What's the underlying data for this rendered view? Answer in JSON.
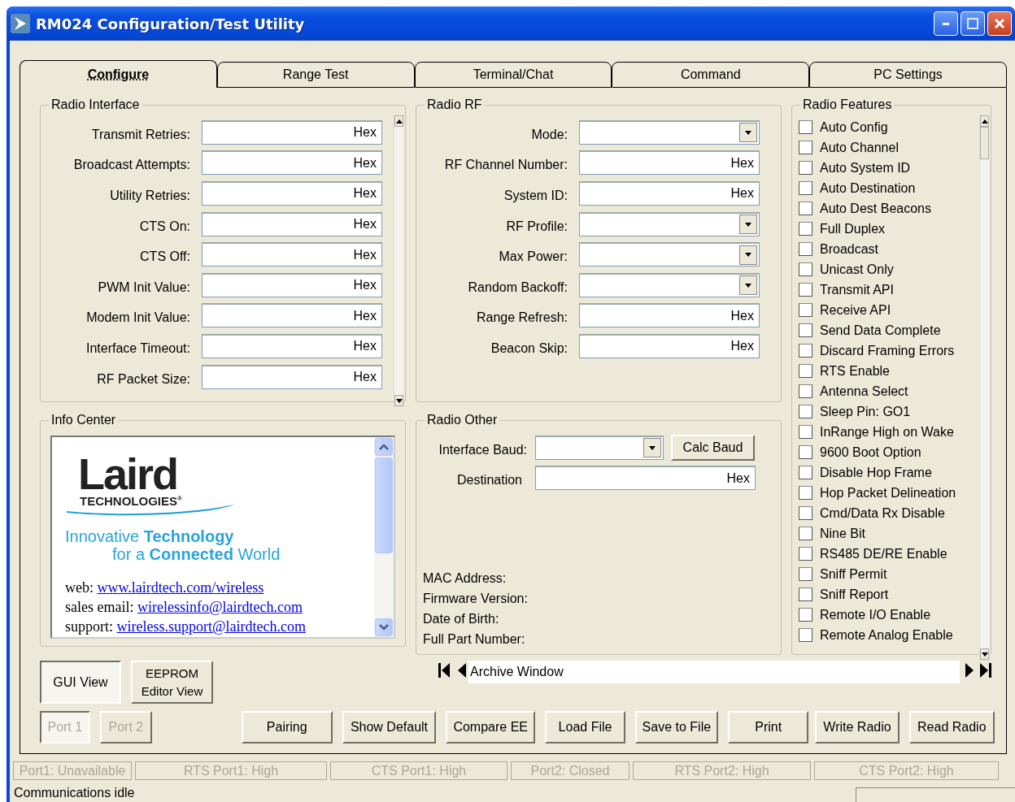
{
  "window": {
    "title": "RM024 Configuration/Test Utility"
  },
  "tabs": [
    {
      "label": "Configure",
      "selected": true
    },
    {
      "label": "Range Test",
      "selected": false
    },
    {
      "label": "Terminal/Chat",
      "selected": false
    },
    {
      "label": "Command",
      "selected": false
    },
    {
      "label": "PC Settings",
      "selected": false
    }
  ],
  "radio_interface": {
    "title": "Radio Interface",
    "fields": [
      {
        "label": "Transmit Retries:",
        "suffix": "Hex"
      },
      {
        "label": "Broadcast Attempts:",
        "suffix": "Hex"
      },
      {
        "label": "Utility Retries:",
        "suffix": "Hex"
      },
      {
        "label": "CTS On:",
        "suffix": "Hex"
      },
      {
        "label": "CTS Off:",
        "suffix": "Hex"
      },
      {
        "label": "PWM Init Value:",
        "suffix": "Hex"
      },
      {
        "label": "Modem Init Value:",
        "suffix": "Hex"
      },
      {
        "label": "Interface Timeout:",
        "suffix": "Hex"
      },
      {
        "label": "RF Packet Size:",
        "suffix": "Hex"
      }
    ]
  },
  "radio_rf": {
    "title": "Radio RF",
    "fields": [
      {
        "label": "Mode:",
        "kind": "dropdown"
      },
      {
        "label": "RF Channel Number:",
        "kind": "hex",
        "suffix": "Hex"
      },
      {
        "label": "System ID:",
        "kind": "hex",
        "suffix": "Hex"
      },
      {
        "label": "RF Profile:",
        "kind": "dropdown"
      },
      {
        "label": "Max Power:",
        "kind": "dropdown"
      },
      {
        "label": "Random Backoff:",
        "kind": "dropdown"
      },
      {
        "label": "Range Refresh:",
        "kind": "hex",
        "suffix": "Hex"
      },
      {
        "label": "Beacon Skip:",
        "kind": "hex",
        "suffix": "Hex"
      }
    ]
  },
  "radio_features": {
    "title": "Radio Features",
    "items": [
      {
        "label": "Auto Config",
        "checked": false
      },
      {
        "label": "Auto Channel",
        "checked": false
      },
      {
        "label": "Auto System ID",
        "checked": false
      },
      {
        "label": "Auto Destination",
        "checked": false
      },
      {
        "label": "Auto Dest Beacons",
        "checked": false
      },
      {
        "label": "Full Duplex",
        "checked": false
      },
      {
        "label": "Broadcast",
        "checked": false
      },
      {
        "label": "Unicast Only",
        "checked": false
      },
      {
        "label": "Transmit API",
        "checked": false
      },
      {
        "label": "Receive API",
        "checked": false
      },
      {
        "label": "Send Data Complete",
        "checked": false
      },
      {
        "label": "Discard Framing Errors",
        "checked": false
      },
      {
        "label": "RTS Enable",
        "checked": false
      },
      {
        "label": "Antenna Select",
        "checked": false
      },
      {
        "label": "Sleep Pin: GO1",
        "checked": false
      },
      {
        "label": "InRange High on Wake",
        "checked": false
      },
      {
        "label": "9600 Boot Option",
        "checked": false
      },
      {
        "label": "Disable Hop Frame",
        "checked": false
      },
      {
        "label": "Hop Packet Delineation",
        "checked": false
      },
      {
        "label": "Cmd/Data Rx Disable",
        "checked": false
      },
      {
        "label": "Nine Bit",
        "checked": false
      },
      {
        "label": "RS485 DE/RE Enable",
        "checked": false
      },
      {
        "label": "Sniff Permit",
        "checked": false
      },
      {
        "label": "Sniff Report",
        "checked": false
      },
      {
        "label": "Remote I/O Enable",
        "checked": false
      },
      {
        "label": "Remote Analog Enable",
        "checked": false
      }
    ]
  },
  "info_center": {
    "title": "Info Center",
    "logo": {
      "name": "Laird",
      "sub": "TECHNOLOGIES",
      "mark": "®"
    },
    "tagline": [
      "Innovative **Technology**",
      "for a **Connected** World"
    ],
    "links": [
      {
        "label": "web:",
        "link": "www.lairdtech.com/wireless"
      },
      {
        "label": "sales email:",
        "link": "wirelessinfo@lairdtech.com"
      },
      {
        "label": "support:",
        "link": "wireless.support@lairdtech.com"
      }
    ]
  },
  "radio_other": {
    "title": "Radio Other",
    "baud_label": "Interface Baud:",
    "calc_button": "Calc Baud",
    "destination_label": "Destination",
    "destination_suffix": "Hex",
    "info_labels": [
      "MAC Address:",
      "Firmware Version:",
      "Date of Birth:",
      "Full Part Number:"
    ]
  },
  "view_buttons": [
    {
      "label": "GUI View",
      "selected": true
    },
    {
      "label": "EEPROM Editor View",
      "selected": false
    }
  ],
  "archive": {
    "value": "Archive Window"
  },
  "port_buttons": [
    {
      "label": "Port 1",
      "selected": true,
      "disabled": true
    },
    {
      "label": "Port 2",
      "selected": false,
      "disabled": true
    }
  ],
  "action_buttons": [
    "Pairing",
    "Show Default",
    "Compare EE",
    "Load File",
    "Save to File",
    "Print",
    "Write Radio",
    "Read Radio"
  ],
  "status_panels": [
    {
      "text": "Port1: Unavailable",
      "disabled": true
    },
    {
      "text": "RTS Port1: High",
      "disabled": true
    },
    {
      "text": "CTS Port1: High",
      "disabled": true
    },
    {
      "text": "Port2: Closed",
      "disabled": true
    },
    {
      "text": "RTS Port2: High",
      "disabled": true
    },
    {
      "text": "CTS Port2: High",
      "disabled": true
    }
  ],
  "status_bar": {
    "text": "Communications idle"
  }
}
